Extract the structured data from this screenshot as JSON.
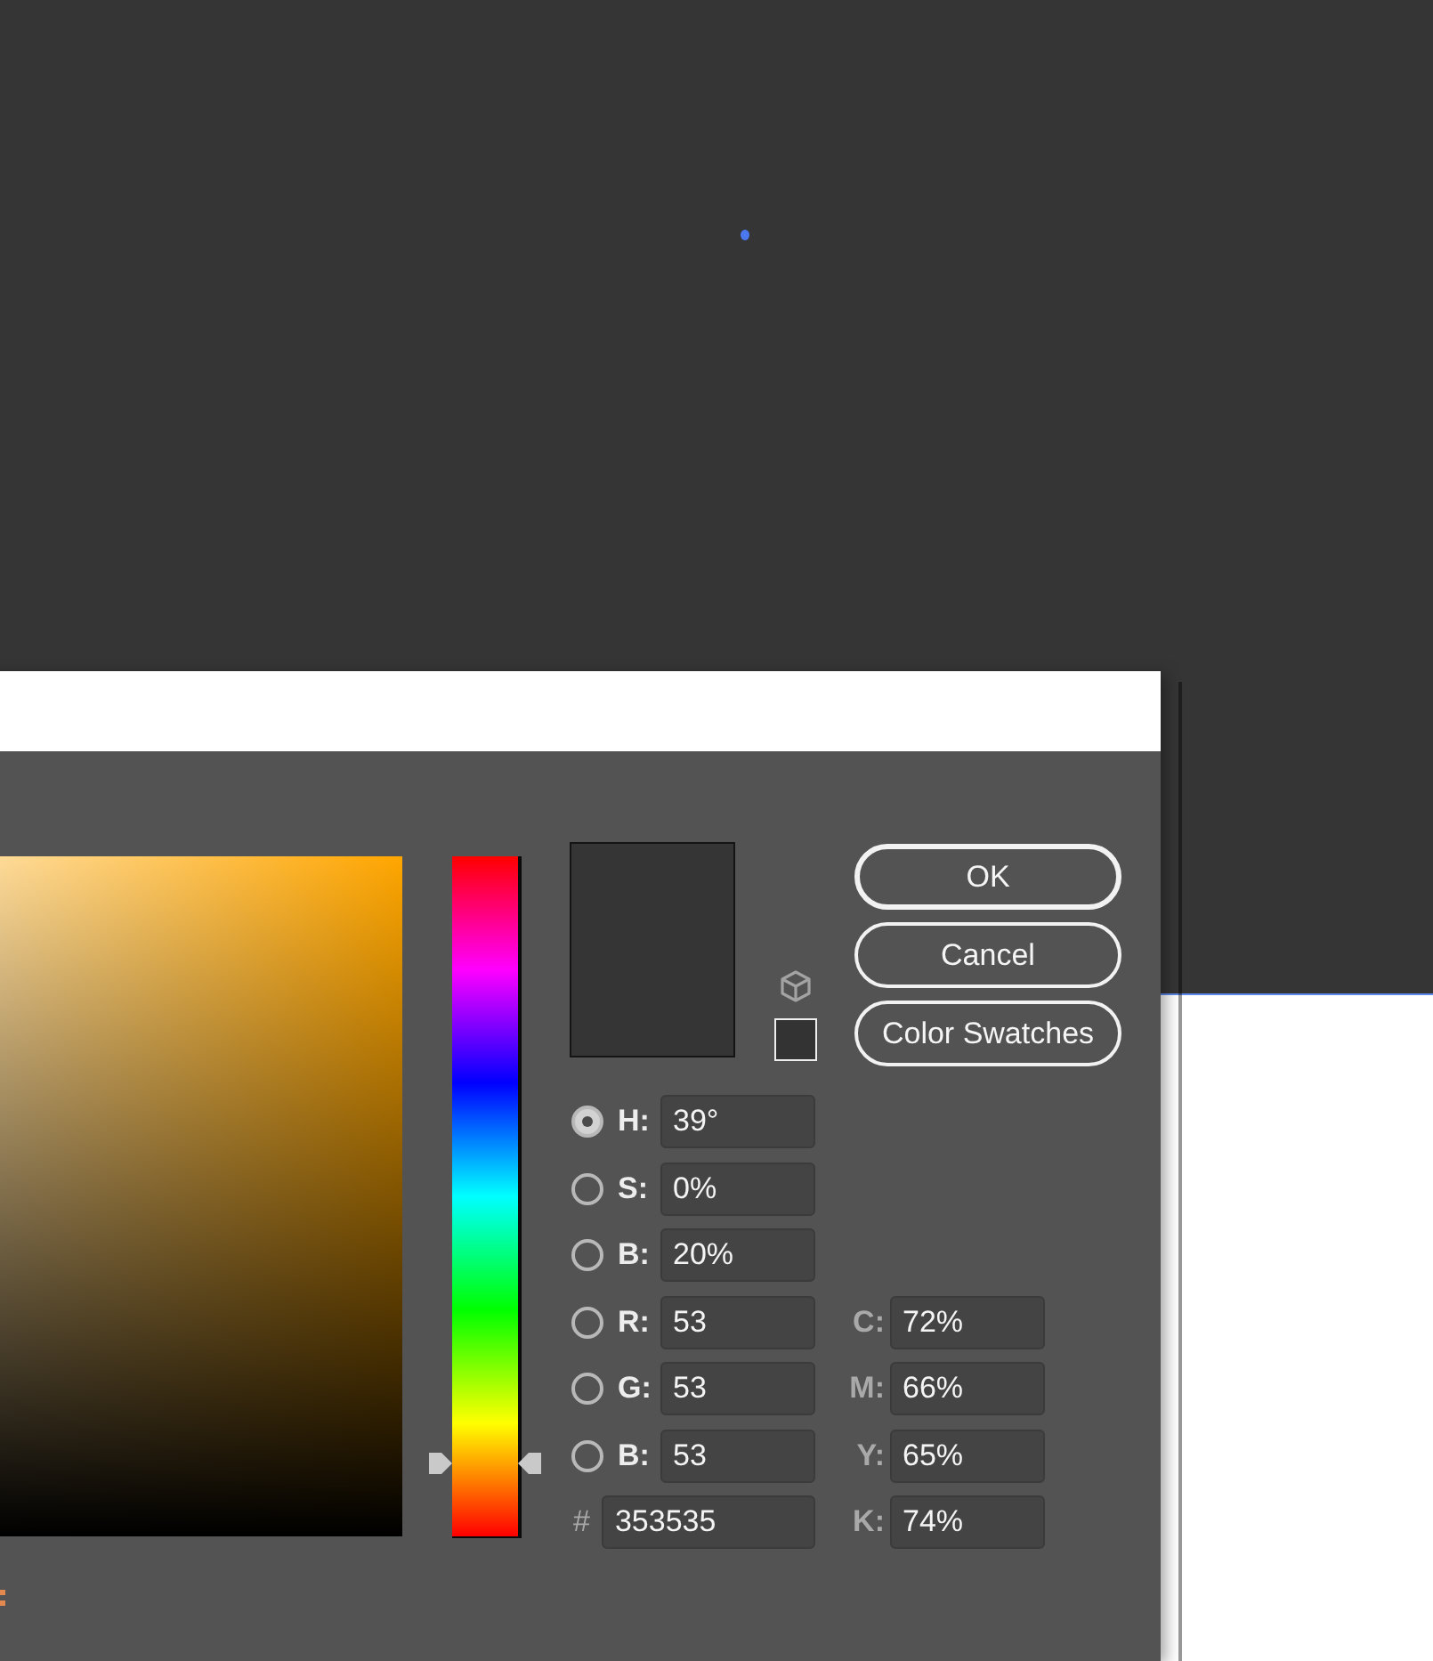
{
  "dialog": {
    "hue_slider": {
      "level": 0.11
    },
    "buttons": [
      {
        "label": "OK",
        "default": true
      },
      {
        "label": "Cancel",
        "default": false
      },
      {
        "label": "Color Swatches",
        "default": false
      }
    ],
    "fields": [
      {
        "label": "H:",
        "value": "39°",
        "selected": true
      },
      {
        "label": "S:",
        "value": "0%",
        "selected": false
      },
      {
        "label": "B:",
        "value": "20%",
        "selected": false
      },
      {
        "label": "R:",
        "value": "53",
        "selected": false
      },
      {
        "label": "G:",
        "value": "53",
        "selected": false
      },
      {
        "label": "B:",
        "value": "53",
        "selected": false
      }
    ],
    "hex_field": {
      "label": "#",
      "value": "353535"
    },
    "cmyk_fields": [
      {
        "label": "C:",
        "value": "72%"
      },
      {
        "label": "M:",
        "value": "66%"
      },
      {
        "label": "Y:",
        "value": "65%"
      },
      {
        "label": "K:",
        "value": "74%"
      }
    ]
  }
}
